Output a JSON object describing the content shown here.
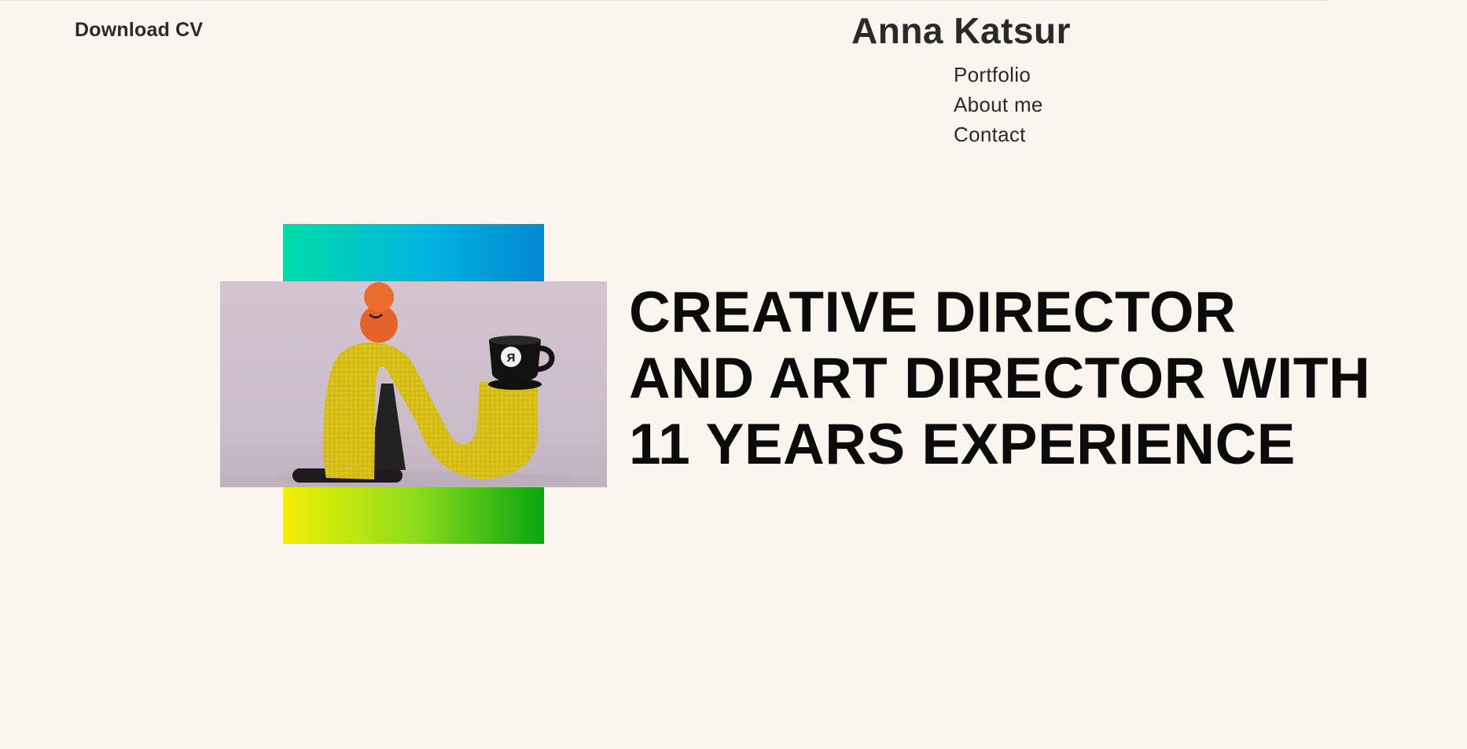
{
  "header": {
    "cv_label": "Download CV",
    "site_title": "Anna Katsur",
    "nav": [
      {
        "label": "Portfolio"
      },
      {
        "label": "About me"
      },
      {
        "label": "Contact"
      }
    ]
  },
  "hero": {
    "headline_lines": [
      "CREATIVE DIRECTOR",
      "AND ART DIRECTOR WITH",
      "11 YEARS EXPERIENCE"
    ],
    "image_mug_glyph": "Я"
  },
  "colors": {
    "background": "#faf5ef",
    "text": "#0b0b0b",
    "gradient_top": [
      "#00dca8",
      "#00b4e0",
      "#0288d1"
    ],
    "gradient_bottom": [
      "#f3ef06",
      "#8fdc1b",
      "#0aa512"
    ]
  }
}
